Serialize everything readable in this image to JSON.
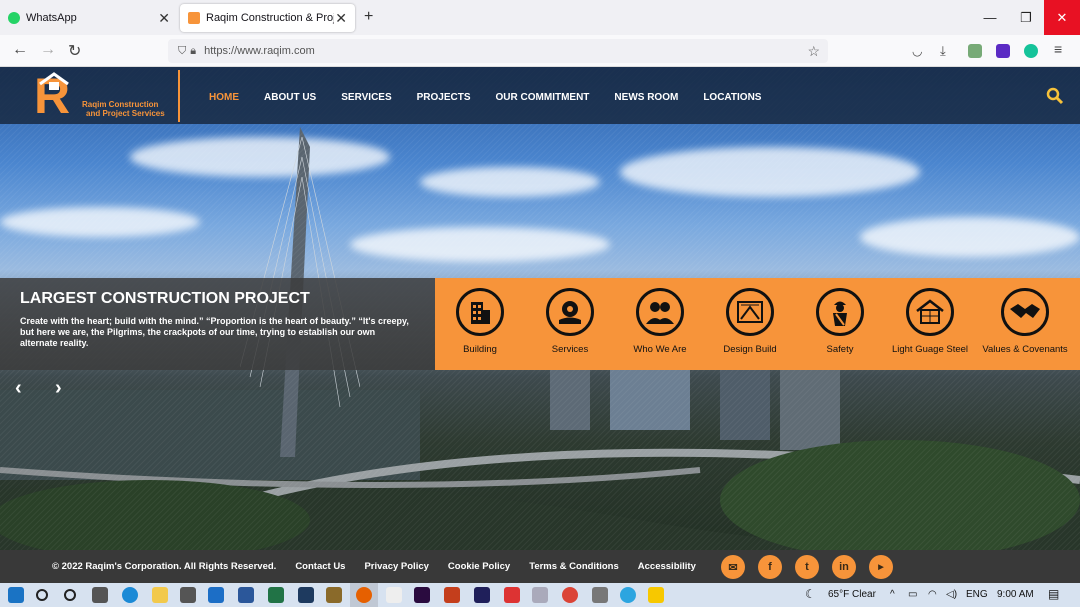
{
  "browser": {
    "tabs": [
      {
        "title": "WhatsApp",
        "favicon_color": "#25d366"
      },
      {
        "title": "Raqim Construction & Project S",
        "favicon_color": "#f7943a"
      }
    ],
    "url": "https://www.raqim.com"
  },
  "site": {
    "logo_letter": "R",
    "logo_line1": "Raqim Construction",
    "logo_line2": "and Project Services",
    "menu": [
      "HOME",
      "ABOUT US",
      "SERVICES",
      "PROJECTS",
      "OUR COMMITMENT",
      "NEWS ROOM",
      "LOCATIONS"
    ],
    "active_menu": "HOME",
    "accent_color": "#f7943a"
  },
  "hero": {
    "title": "LARGEST CONSTRUCTION PROJECT",
    "text": "Create with the heart; build with the mind.” “Proportion is the heart of beauty.” “It's creepy, but here we are, the Pilgrims, the crackpots of our time, trying to establish our own alternate reality.",
    "prev_label": "‹",
    "next_label": "›"
  },
  "features": [
    {
      "label": "Building",
      "icon": "building-icon"
    },
    {
      "label": "Services",
      "icon": "gear-hand-icon"
    },
    {
      "label": "Who We Are",
      "icon": "people-icon"
    },
    {
      "label": "Design Build",
      "icon": "blueprint-icon"
    },
    {
      "label": "Safety",
      "icon": "worker-icon"
    },
    {
      "label": "Light Guage Steel",
      "icon": "house-frame-icon"
    },
    {
      "label": "Values & Covenants",
      "icon": "handshake-icon"
    }
  ],
  "footer": {
    "copyright": "© 2022 Raqim's Corporation. All Rights Reserved.",
    "links": [
      "Contact Us",
      "Privacy Policy",
      "Cookie Policy",
      "Terms & Conditions",
      "Accessibility"
    ],
    "social": [
      "email-icon",
      "facebook-icon",
      "twitter-icon",
      "linkedin-icon",
      "youtube-icon"
    ]
  },
  "taskbar": {
    "weather": "65°F  Clear",
    "lang": "ENG",
    "time": "9:00 AM"
  }
}
